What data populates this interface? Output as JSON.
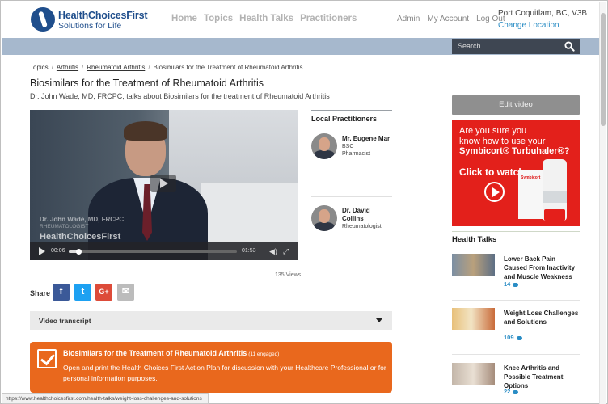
{
  "header": {
    "brand_name": "HealthChoicesFirst",
    "brand_tagline": "Solutions for Life",
    "nav": [
      "Home",
      "Topics",
      "Health Talks",
      "Practitioners"
    ],
    "user_nav": [
      "Admin",
      "My Account",
      "Log Out"
    ],
    "location": "Port Coquitlam, BC, V3B",
    "change_location": "Change Location"
  },
  "search": {
    "placeholder": "Search"
  },
  "breadcrumb": {
    "items": [
      "Topics",
      "Arthritis",
      "Rheumatoid Arthritis"
    ],
    "current": "Biosimilars for the Treatment of Rheumatoid Arthritis",
    "separator": "/"
  },
  "page": {
    "title": "Biosimilars for the Treatment of Rheumatoid Arthritis",
    "subtitle": "Dr. John Wade, MD, FRCPC, talks about Biosimilars for the treatment of Rheumatoid Arthritis"
  },
  "video": {
    "watermark_name": "Dr. John Wade, MD, FRCPC",
    "watermark_role": "RHEUMATOLOGIST",
    "watermark_brand": "HealthChoicesFirst",
    "current_time": "00:06",
    "duration": "01:53",
    "progress_fraction": 0.06,
    "views": "135 Views"
  },
  "share": {
    "label": "Share",
    "buttons": [
      {
        "name": "facebook",
        "glyph": "f",
        "color": "#3b5998"
      },
      {
        "name": "twitter",
        "glyph": "t",
        "color": "#1da1f2"
      },
      {
        "name": "google-plus",
        "glyph": "G+",
        "color": "#dd4b39"
      },
      {
        "name": "email",
        "glyph": "✉",
        "color": "#bcbcbc"
      }
    ]
  },
  "transcript": {
    "label": "Video transcript"
  },
  "action_plan": {
    "title": "Biosimilars for the Treatment of Rheumatoid Arthritis",
    "count": "(11 engaged)",
    "description": "Open and print the Health Choices First Action Plan for discussion with your Healthcare Professional or for personal information purposes."
  },
  "local_practitioners": {
    "title": "Local Practitioners",
    "items": [
      {
        "name": "Mr. Eugene Mar",
        "line1": "BSC",
        "line2": "Pharmacist"
      },
      {
        "name_line1": "Dr. David",
        "name_line2": "Collins",
        "line1": "Rheumatologist"
      }
    ]
  },
  "sidebar": {
    "edit_video": "Edit video",
    "ad": {
      "line1": "Are you sure you",
      "line2": "know how to use your",
      "line3": "Symbicort® Turbuhaler®?",
      "cta": "Click to watch",
      "product": "Symbicort"
    },
    "health_talks": {
      "title": "Health Talks",
      "items": [
        {
          "title": "Lower Back Pain Caused From Inactivity and Muscle Weakness",
          "count": "14"
        },
        {
          "title": "Weight Loss Challenges and Solutions",
          "count": "109"
        },
        {
          "title": "Knee Arthritis and Possible Treatment Options",
          "count": "22"
        }
      ]
    }
  },
  "status_bar": {
    "url": "https://www.healthchoicesfirst.com/health-talks/weight-loss-challenges-and-solutions"
  }
}
